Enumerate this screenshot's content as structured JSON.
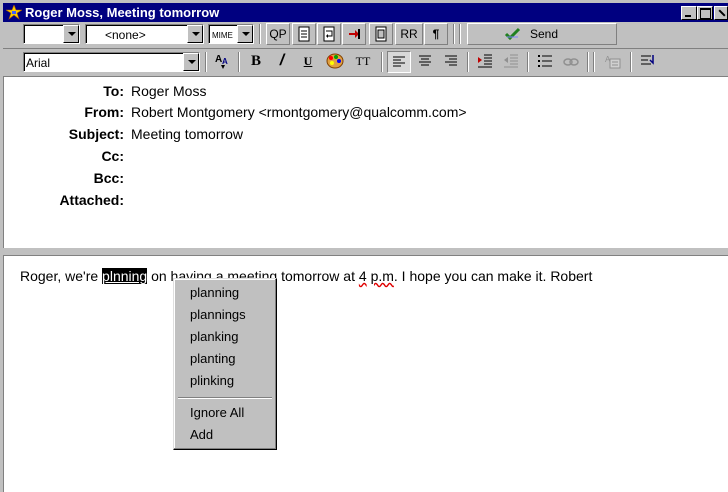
{
  "window": {
    "title": "Roger Moss, Meeting tomorrow"
  },
  "toolbar1": {
    "priority_value": "",
    "signature_value": "<none>",
    "mime_label": "MIME",
    "qp_label": "QP",
    "rr_label": "RR",
    "pilcrow_label": "¶",
    "send_label": "Send"
  },
  "toolbar2": {
    "font_value": "Arial",
    "bold_label": "B",
    "italic_label": "/",
    "underline_label": "U",
    "tt_label": "TT"
  },
  "header": {
    "to_label": "To:",
    "to_value": "Roger Moss",
    "from_label": "From:",
    "from_value": "Robert Montgomery <rmontgomery@qualcomm.com>",
    "subject_label": "Subject:",
    "subject_value": "Meeting tomorrow",
    "cc_label": "Cc:",
    "bcc_label": "Bcc:",
    "attached_label": "Attached:"
  },
  "body": {
    "text_before": "Roger, we're ",
    "misspelled": "plnning",
    "text_middle": " on having a meeting  tomorrow at ",
    "num4": "4",
    "space": " ",
    "pm": "p.m",
    "text_after": ". I hope you can make it. Robert"
  },
  "spell_menu": {
    "suggestions": [
      "planning",
      "plannings",
      "planking",
      "planting",
      "plinking"
    ],
    "ignore_all": "Ignore All",
    "add": "Add"
  },
  "colors": {
    "title_bg": "#000080",
    "face": "#c0c0c0",
    "squiggle": "#e00000"
  }
}
